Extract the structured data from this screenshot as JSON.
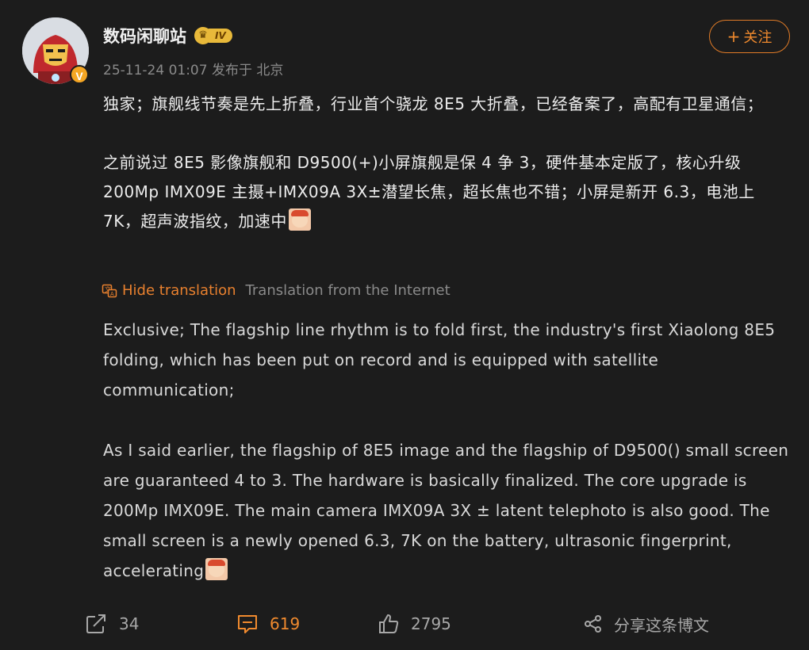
{
  "user": {
    "name": "数码闲聊站",
    "level": "IV",
    "verified_badge": "V"
  },
  "meta": {
    "timestamp": "25-11-24 01:07",
    "location": "发布于 北京"
  },
  "follow_button": {
    "plus": "+",
    "label": "关注"
  },
  "post": {
    "para1": "独家；旗舰线节奏是先上折叠，行业首个骁龙 8E5 大折叠，已经备案了，高配有卫星通信；",
    "para2": "之前说过 8E5 影像旗舰和 D9500(+)小屏旗舰是保 4 争 3，硬件基本定版了，核心升级 200Mp IMX09E 主摄+IMX09A 3X±潜望长焦，超长焦也不错；小屏是新开 6.3，电池上 7K，超声波指纹，加速中"
  },
  "translation": {
    "hide_label": "Hide translation",
    "source_label": "Translation from the Internet",
    "para1": "Exclusive; The flagship line rhythm is to fold first, the industry's first Xiaolong 8E5 folding, which has been put on record and is equipped with satellite communication;",
    "para2": "As I said earlier, the flagship of 8E5 image and the flagship of D9500() small screen are guaranteed 4 to 3. The hardware is basically finalized. The core upgrade is 200Mp IMX09E. The main camera IMX09A 3X ± latent telephoto is also good. The small screen is a newly opened 6.3, 7K on the battery, ultrasonic fingerprint, accelerating"
  },
  "footer": {
    "repost_count": "34",
    "comment_count": "619",
    "like_count": "2795",
    "share_label": "分享这条博文"
  },
  "colors": {
    "background": "#1c1c1c",
    "accent": "#f08a2e",
    "muted": "#8a8a8a"
  },
  "icons": [
    "repost-icon",
    "comment-icon",
    "like-icon",
    "share-icon",
    "translate-icon",
    "level-crown-icon",
    "verified-icon",
    "emoji-sticker"
  ]
}
